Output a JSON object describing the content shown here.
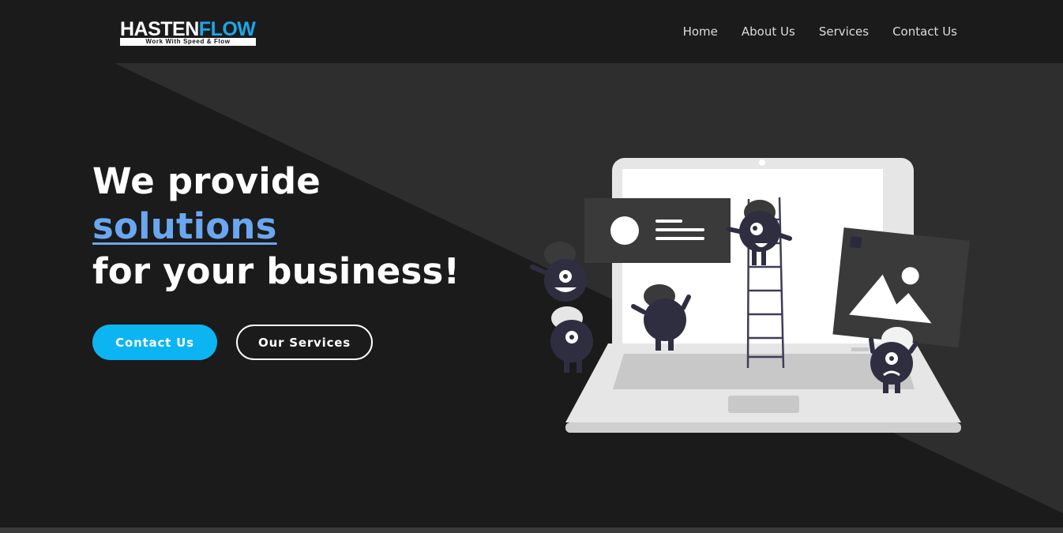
{
  "brand": {
    "name_part1": "HASTEN",
    "name_part2": "FLOW",
    "tagline": "Work With Speed & Flow",
    "accent_color": "#1aa8e8"
  },
  "nav": {
    "items": [
      {
        "label": "Home"
      },
      {
        "label": "About Us"
      },
      {
        "label": "Services"
      },
      {
        "label": "Contact Us"
      }
    ]
  },
  "hero": {
    "line1": "We provide",
    "line2": "solutions",
    "line3": "for your business!",
    "highlight_color": "#6aa7f0",
    "primary_button": "Contact Us",
    "secondary_button": "Our Services",
    "primary_button_color": "#0db4f2"
  },
  "illustration": {
    "description_icons": [
      "laptop-icon",
      "profile-card-icon",
      "image-frame-icon",
      "ladder-icon",
      "character-icons"
    ]
  }
}
